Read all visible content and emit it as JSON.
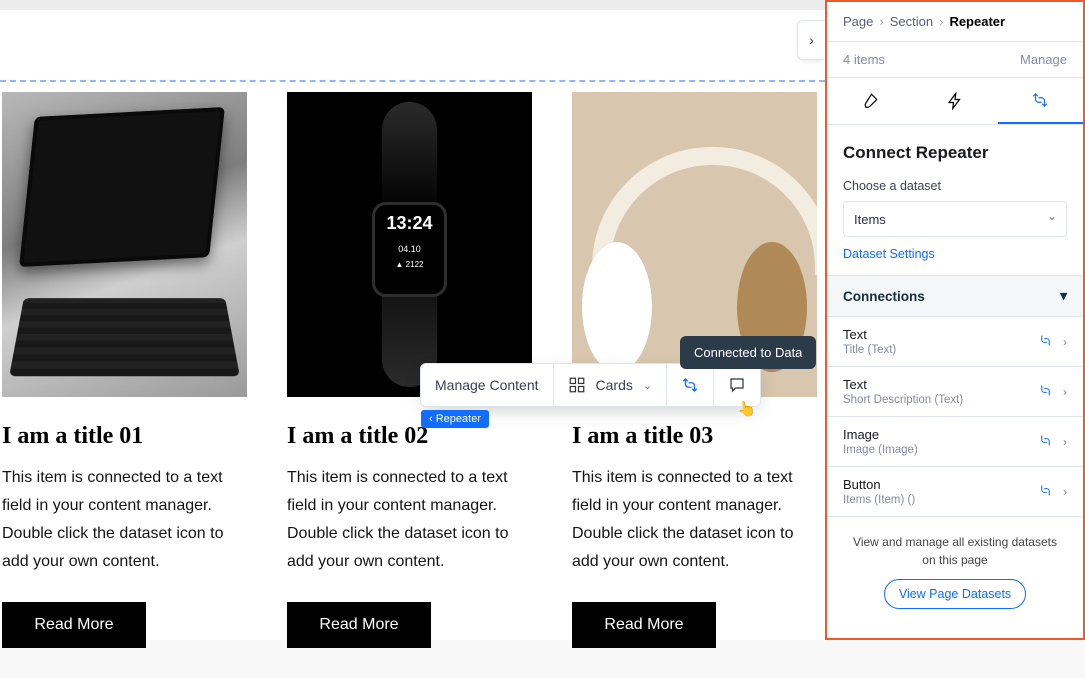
{
  "breadcrumb": {
    "a": "Page",
    "b": "Section",
    "c": "Repeater"
  },
  "meta": {
    "count": "4 items",
    "manage": "Manage"
  },
  "panel": {
    "title": "Connect Repeater",
    "choose_label": "Choose a dataset",
    "dataset_value": "Items",
    "dataset_settings": "Dataset Settings",
    "connections_label": "Connections",
    "rows": [
      {
        "name": "Text",
        "sub": "Title (Text)"
      },
      {
        "name": "Text",
        "sub": "Short Description (Text)"
      },
      {
        "name": "Image",
        "sub": "Image (Image)"
      },
      {
        "name": "Button",
        "sub": "Items (Item) ()"
      }
    ],
    "foot_text": "View and manage all existing datasets on this page",
    "foot_button": "View Page Datasets"
  },
  "toolbar": {
    "manage": "Manage Content",
    "layout": "Cards",
    "tooltip": "Connected to Data",
    "tag": "‹ Repeater"
  },
  "watch": {
    "time": "13:24",
    "date": "04.10",
    "steps": "▲ 2122"
  },
  "cards": [
    {
      "title": "I am a title 01",
      "body": "This item is connected to a text field in your content manager. Double click the dataset icon to add your own content.",
      "cta": "Read More"
    },
    {
      "title": "I am a title 02",
      "body": "This item is connected to a text field in your content manager. Double click the dataset icon to add your own content.",
      "cta": "Read More"
    },
    {
      "title": "I am a title 03",
      "body": "This item is connected to a text field in your content manager. Double click the dataset icon to add your own content.",
      "cta": "Read More"
    }
  ]
}
